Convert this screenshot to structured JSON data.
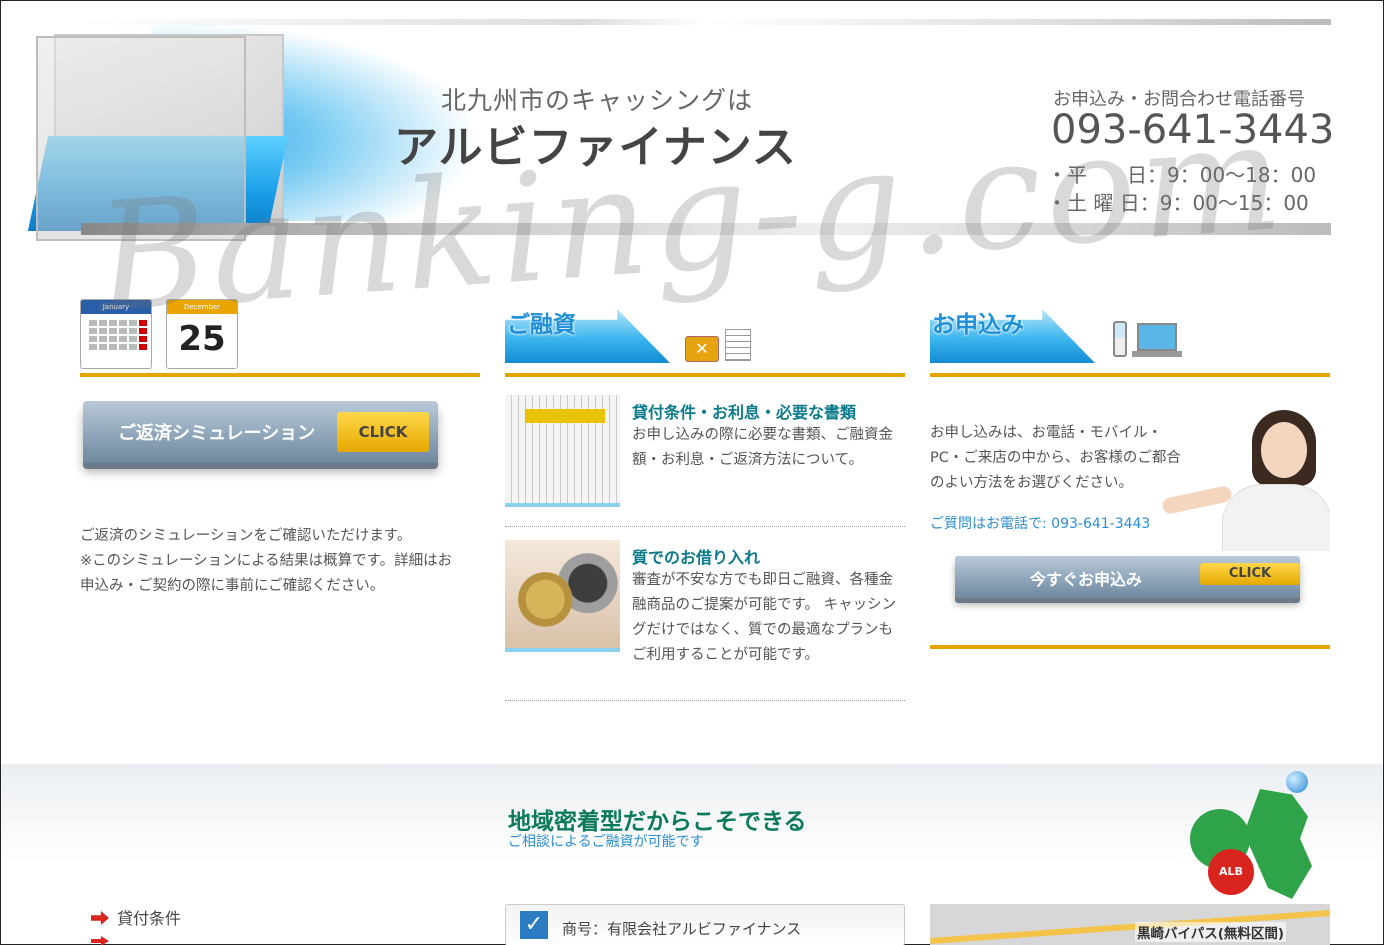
{
  "header": {
    "catchphrase": "北九州市のキャッシングは",
    "company_logo_text": "アルビファイナンス",
    "phone_label": "お申込み・お問合わせ電話番号",
    "phone_number": "093-641-3443",
    "hours": "・平　　日：9：00〜18：00\n・土 曜 日：9：00〜15：00"
  },
  "watermark": "Banking-g.com",
  "col1": {
    "cal1_month": "January",
    "cal2_month": "December",
    "cal2_day": "25",
    "sim_button_label": "ご返済シミュレーション",
    "click_label": "CLICK",
    "desc": "ご返済のシミュレーションをご確認いただけます。\n※このシミュレーションによる結果は概算です。詳細はお\n申込み・ご契約の際に事前にご確認ください。"
  },
  "col2": {
    "section_title": "ご融資",
    "items": [
      {
        "title": "貸付条件・お利息・必要な書類",
        "text": "お申し込みの際に必要な書類、ご融資金額・お利息・ご返済方法について。"
      },
      {
        "title": "質でのお借り入れ",
        "text": "審査が不安な方でも即日ご融資、各種金融商品のご提案が可能です。 キャッシングだけではなく、質での最適なプランもご利用することが可能です。"
      }
    ]
  },
  "col3": {
    "section_title": "お申込み",
    "text": "お申し込みは、お電話・モバイル・\nPC・ご来店の中から、お客様のご都合\nのよい方法をお選びください。",
    "tel_text": "ご質問はお電話で: 093-641-3443",
    "apply_button_label": "今すぐお申込み",
    "click_label": "CLICK"
  },
  "band": {
    "title": "地域密着型だからこそできる",
    "subtitle": "ご相談によるご融資が可能です",
    "mascot_badge": "ALB"
  },
  "footer": {
    "menu_item_1": "貸付条件",
    "info_text": "商号：有限会社アルビファイナンス",
    "map_label": "黒崎バイパス(無料区間)"
  }
}
